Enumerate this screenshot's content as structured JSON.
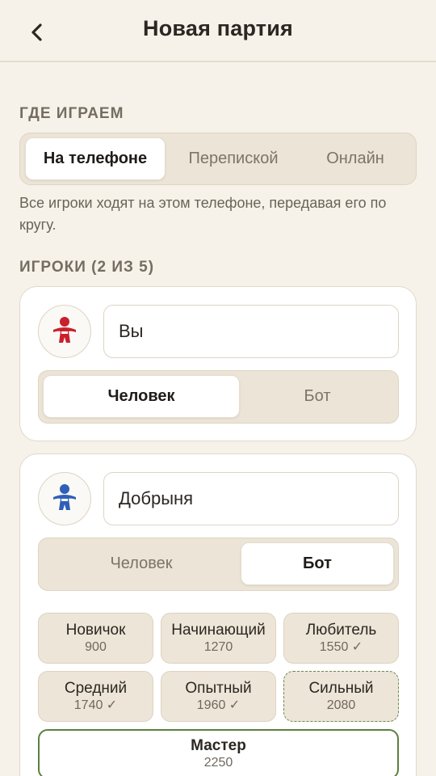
{
  "header": {
    "title": "Новая партия",
    "back_icon": "chevron-left-icon"
  },
  "where": {
    "label": "ГДЕ ИГРАЕМ",
    "options": [
      "На телефоне",
      "Перепиской",
      "Онлайн"
    ],
    "selected": "На телефоне",
    "hint": "Все игроки ходят на этом телефоне, передавая его по кругу."
  },
  "players": {
    "label": "ИГРОКИ (2 ИЗ 5)",
    "list": [
      {
        "name": "Вы",
        "avatar_icon": "player-figure-icon",
        "avatar_color": "#c8202c",
        "type_options": [
          "Человек",
          "Бот"
        ],
        "type_selected": "Человек"
      },
      {
        "name": "Добрыня",
        "avatar_icon": "player-figure-icon",
        "avatar_color": "#2f5fb8",
        "type_options": [
          "Человек",
          "Бот"
        ],
        "type_selected": "Бот",
        "levels": [
          {
            "name": "Новичок",
            "rating": "900"
          },
          {
            "name": "Начинающий",
            "rating": "1270"
          },
          {
            "name": "Любитель",
            "rating": "1550 ✓"
          },
          {
            "name": "Средний",
            "rating": "1740 ✓"
          },
          {
            "name": "Опытный",
            "rating": "1960 ✓"
          },
          {
            "name": "Сильный",
            "rating": "2080"
          },
          {
            "name": "Мастер",
            "rating": "2250"
          }
        ],
        "level_selected": "Мастер",
        "level_suggested": "Сильный"
      }
    ]
  },
  "colors": {
    "background": "#f6f2e9",
    "selected_border": "#5b7f3e",
    "suggested_border": "#6b8a4e"
  }
}
